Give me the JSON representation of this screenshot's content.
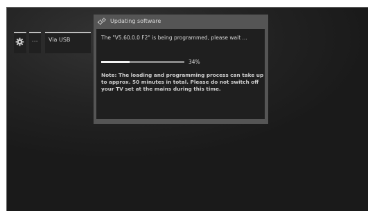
{
  "sidebar": {
    "settings_icon": "gear-icon",
    "more_label": "...",
    "usb_label": "Via USB"
  },
  "dialog": {
    "icon": "gears-icon",
    "title": "Updating software",
    "status_text": "The \"V5.60.0.0 F2\" is being programmed, please wait ...",
    "progress_percent": 34,
    "progress_label": "34%",
    "note": "Note: The loading and programming process can take up to approx. 50 minutes in total. Please do not switch off your TV set at the mains during this time."
  },
  "colors": {
    "screen_background": "#232323",
    "dialog_frame": "#555555",
    "dialog_body": "#1f1f1f",
    "progress_fill": "#f2f2f2",
    "progress_track": "#8a8a8a"
  }
}
